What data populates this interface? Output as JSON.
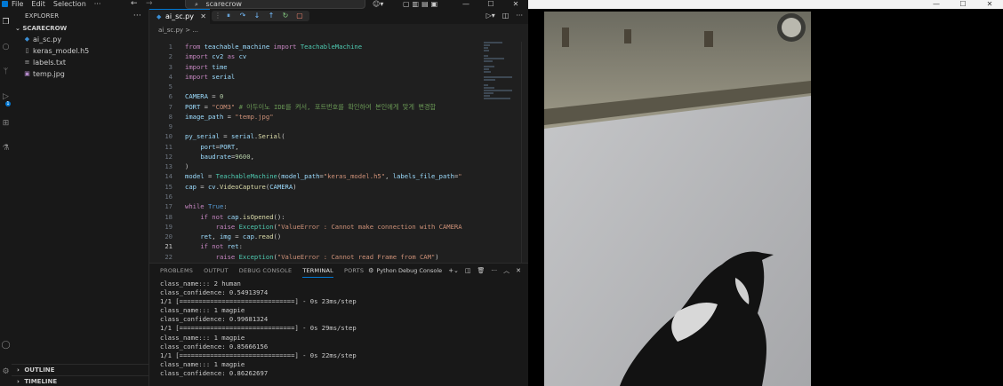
{
  "menu": [
    "File",
    "Edit",
    "Selection",
    "···"
  ],
  "command_center": {
    "text": "scarecrow"
  },
  "explorer": {
    "title": "EXPLORER",
    "folder": "SCARECROW",
    "files": [
      {
        "name": "ai_sc.py",
        "icon": "python-file-icon"
      },
      {
        "name": "keras_model.h5",
        "icon": "file-icon"
      },
      {
        "name": "labels.txt",
        "icon": "text-file-icon"
      },
      {
        "name": "temp.jpg",
        "icon": "image-file-icon"
      }
    ],
    "outline": "OUTLINE",
    "timeline": "TIMELINE"
  },
  "editor": {
    "tab": "ai_sc.py",
    "breadcrumb": "ai_sc.py > ...",
    "lines": [
      "from teachable_machine import TeachableMachine",
      "import cv2 as cv",
      "import time",
      "import serial",
      "",
      "CAMERA = 0",
      "PORT = \"COM3\" # 아두이노 IDE를 켜서, 포트번호를 확인하여 본인에게 맞게 변경합",
      "image_path = \"temp.jpg\"",
      "",
      "py_serial = serial.Serial(",
      "    port=PORT,",
      "    baudrate=9600,",
      ")",
      "model = TeachableMachine(model_path=\"keras_model.h5\", labels_file_path=\"",
      "cap = cv.VideoCapture(CAMERA)",
      "",
      "while True:",
      "    if not cap.isOpened():",
      "        raise Exception(\"ValueError : Cannot make connection with CAMERA",
      "    ret, img = cap.read()",
      "    if not ret:",
      "        raise Exception(\"ValueError : Cannot read Frame from CAM\")"
    ],
    "current_line": 21
  },
  "panel": {
    "tabs": [
      "PROBLEMS",
      "OUTPUT",
      "DEBUG CONSOLE",
      "TERMINAL",
      "PORTS"
    ],
    "active_tab": "TERMINAL",
    "terminal_name": "Python Debug Console",
    "terminal_lines": [
      "class_name::: 2 human",
      "class_confidence: 0.54913974",
      "1/1 [==============================] - 0s 23ms/step",
      "class_name::: 1 magpie",
      "class_confidence: 0.99681324",
      "1/1 [==============================] - 0s 29ms/step",
      "class_name::: 1 magpie",
      "class_confidence: 0.85666156",
      "1/1 [==============================] - 0s 22ms/step",
      "class_name::: 1 magpie",
      "class_confidence: 0.86262697"
    ]
  },
  "colors": {
    "accent": "#0078d4",
    "editor_bg": "#1f1f1f",
    "sidebar_bg": "#181818"
  }
}
